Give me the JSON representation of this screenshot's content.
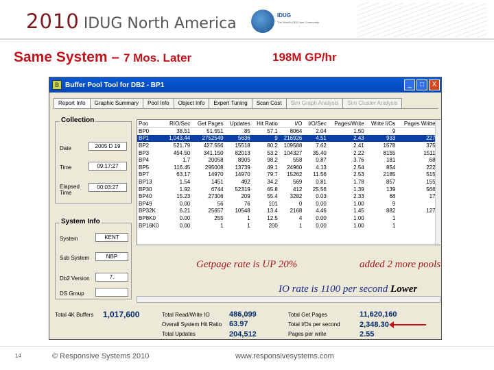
{
  "header": {
    "year": "2010",
    "org": "IDUG North America",
    "logo_text": "IDUG",
    "logo_sub": "The World's DB2 User Community"
  },
  "slide": {
    "title_main": "Same System – ",
    "title_sub": "7 Mos. Later",
    "rate": "198M GP/hr"
  },
  "window": {
    "title": "Buffer Pool Tool for DB2 - BP1",
    "icon": "app-icon",
    "buttons": {
      "minimize": "_",
      "maximize": "□",
      "close": "X"
    },
    "tabs": [
      {
        "label": "Report Info",
        "state": "active"
      },
      {
        "label": "Graphic Summary",
        "state": "normal"
      },
      {
        "label": "Pool Info",
        "state": "normal"
      },
      {
        "label": "Object Info",
        "state": "normal"
      },
      {
        "label": "Expert Tuning",
        "state": "normal"
      },
      {
        "label": "Scan Cost",
        "state": "normal"
      },
      {
        "label": "Sim Graph Analysis",
        "state": "disabled"
      },
      {
        "label": "Sim Cluster Analysis",
        "state": "disabled"
      }
    ]
  },
  "collection": {
    "title": "Collection",
    "date_label": "Date",
    "date_value": "2005 D 19",
    "time_label": "Time",
    "time_value": "09:17:27",
    "elapsed_label": "Elapsed Time",
    "elapsed_value": "00:03:27"
  },
  "system_info": {
    "title": "System Info",
    "system_label": "System",
    "system_value": "KENT",
    "subsystem_label": "Sub System",
    "subsystem_value": "NBP",
    "db2_label": "Db2 Version",
    "db2_value": "7.",
    "ds_label": "DS Group",
    "ds_value": ""
  },
  "grid": {
    "columns": [
      "Poo",
      "RIO/Sec",
      "Get Pages",
      "Updates",
      "Hit Ratio",
      "I/O",
      "I/O/Sec",
      "Pages/Write",
      "Write I/Os",
      "Pages Written"
    ],
    "selected_row": 1,
    "rows": [
      [
        "BP0",
        "38.51",
        "51.551",
        "85",
        "57.1",
        "8064",
        "2.04",
        "1.50",
        "9",
        "9"
      ],
      [
        "BP1",
        "1,043.44",
        "2752549",
        "5636",
        "9",
        "216926",
        "4.51",
        "2.43",
        "933",
        "2270"
      ],
      [
        "BP2",
        "521.79",
        "427.556",
        "15518",
        "80.2",
        "109588",
        "7.62",
        "2.41",
        "1578",
        "3757"
      ],
      [
        "BP3",
        "454.50",
        "341.150",
        "82013",
        "53.2",
        "104327",
        "35.40",
        "2.22",
        "8155",
        "15116"
      ],
      [
        "BP4",
        "1.7",
        "20058",
        "8905",
        "98.2",
        "558",
        "0.87",
        "3.76",
        "181",
        "680"
      ],
      [
        "BP5",
        "116.45",
        "295008",
        "13739",
        "49.1",
        "24960",
        "4.13",
        "2.54",
        "854",
        "2226"
      ],
      [
        "BP7",
        "63.17",
        "14970",
        "14970",
        "79.7",
        "15262",
        "11.56",
        "2.53",
        "2185",
        "5150"
      ],
      [
        "BP13",
        "1.54",
        "1451",
        "492",
        "34.2",
        "569",
        "0.81",
        "1.78",
        "857",
        "1557"
      ],
      [
        "BP30",
        "1.92",
        "6744",
        "52319",
        "65.8",
        "412",
        "25.56",
        "1.39",
        "139",
        "5664"
      ],
      [
        "BP40",
        "15.23",
        "27306",
        "209",
        "55.4",
        "3282",
        "0.03",
        "2.33",
        "68",
        "172"
      ],
      [
        "BP49",
        "0.00",
        "56",
        "76",
        "101",
        "0",
        "0.00",
        "1.00",
        "9",
        "9"
      ],
      [
        "BP32K",
        "6.21",
        "25657",
        "10548",
        "13.4",
        "2168",
        "4.46",
        "1.45",
        "882",
        "1277"
      ],
      [
        "BP8K0",
        "0.00",
        "255",
        "1",
        "12.5",
        "4",
        "0.00",
        "1.00",
        "1",
        "1"
      ],
      [
        "BP16K0",
        "0.00",
        "1",
        "1",
        "200",
        "1",
        "0.00",
        "1.00",
        "1",
        "1"
      ]
    ]
  },
  "summary": {
    "total_4k_label": "Total 4K Buffers",
    "total_4k_value": "1,017,600",
    "total_rw_label": "Total Read/Write IO",
    "total_rw_value": "486,099",
    "hit_ratio_label": "Overall System Hit Ratio",
    "hit_ratio_value": "63.97",
    "updates_label": "Total Updates",
    "updates_value": "204,512",
    "get_pages_label": "Total Get Pages",
    "get_pages_value": "11,620,160",
    "ios_label": "Total I/Os per second",
    "ios_value": "2,348.30",
    "ppw_label": "Pages per write",
    "ppw_value": "2.55"
  },
  "annotations": {
    "getpage": "Getpage rate is UP 20%",
    "pools": "added 2 more pools",
    "io_rate": "IO rate is 1100  per second ",
    "io_emph": "Lower"
  },
  "footer": {
    "page": "14",
    "copyright": "© Responsive Systems 2010",
    "url": "www.responsivesystems.com"
  }
}
